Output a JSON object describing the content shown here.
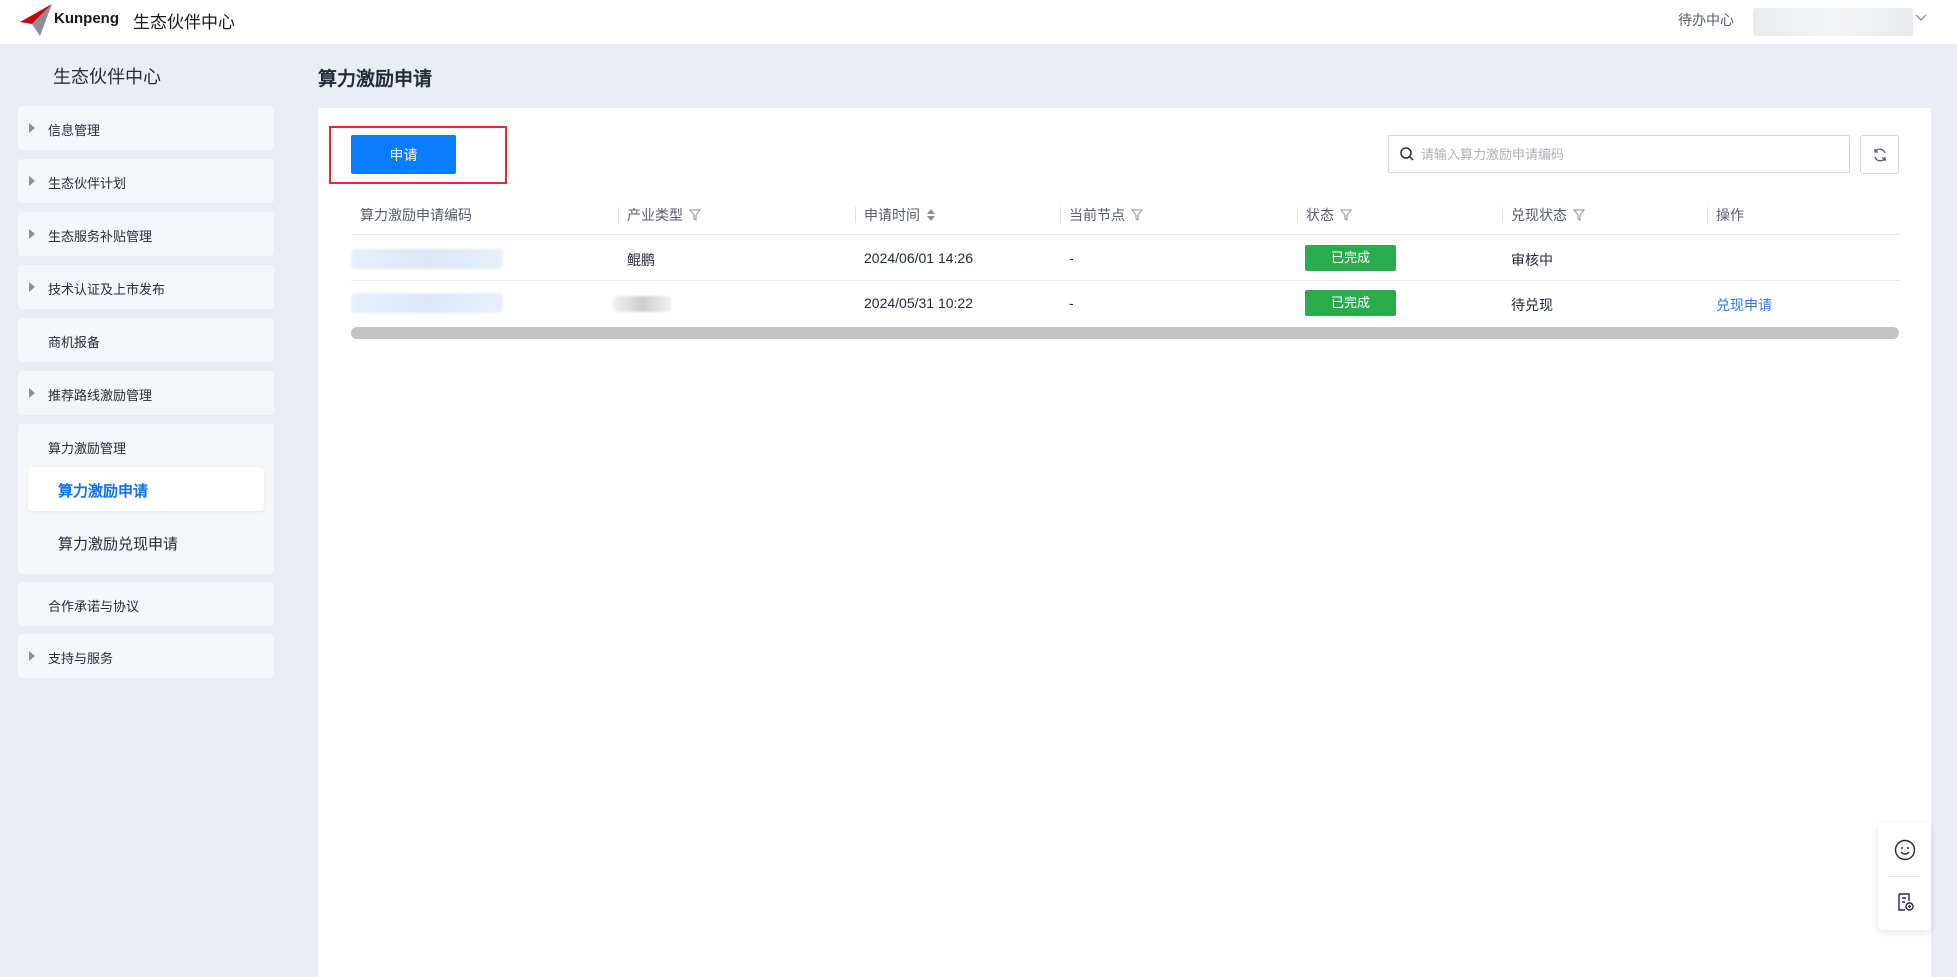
{
  "header": {
    "brand": "Kunpeng",
    "portal_title": "生态伙伴中心",
    "todo_center": "待办中心"
  },
  "sidebar": {
    "title": "生态伙伴中心",
    "items": [
      {
        "label": "信息管理"
      },
      {
        "label": "生态伙伴计划"
      },
      {
        "label": "生态服务补贴管理"
      },
      {
        "label": "技术认证及上市发布"
      },
      {
        "label": "商机报备"
      },
      {
        "label": "推荐路线激励管理"
      },
      {
        "label": "算力激励管理",
        "children": [
          {
            "label": "算力激励申请"
          },
          {
            "label": "算力激励兑现申请"
          }
        ]
      },
      {
        "label": "合作承诺与协议"
      },
      {
        "label": "支持与服务"
      }
    ]
  },
  "main": {
    "page_title": "算力激励申请",
    "apply_button": "申请",
    "search_placeholder": "请输入算力激励申请编码",
    "table": {
      "columns": [
        "算力激励申请编码",
        "产业类型",
        "申请时间",
        "当前节点",
        "状态",
        "兑现状态",
        "操作"
      ],
      "rows": [
        {
          "type": "鲲鹏",
          "time": "2024/06/01 14:26",
          "node": "-",
          "status": "已完成",
          "redeem_status": "审核中",
          "action": ""
        },
        {
          "type": "",
          "time": "2024/05/31 10:22",
          "node": "-",
          "status": "已完成",
          "redeem_status": "待兑现",
          "action": "兑现申请"
        }
      ]
    }
  },
  "colors": {
    "primary": "#0a7cff",
    "success": "#2bac4c",
    "link": "#2d7ae8",
    "highlight": "#e32b2b",
    "background": "#eaeef4"
  }
}
